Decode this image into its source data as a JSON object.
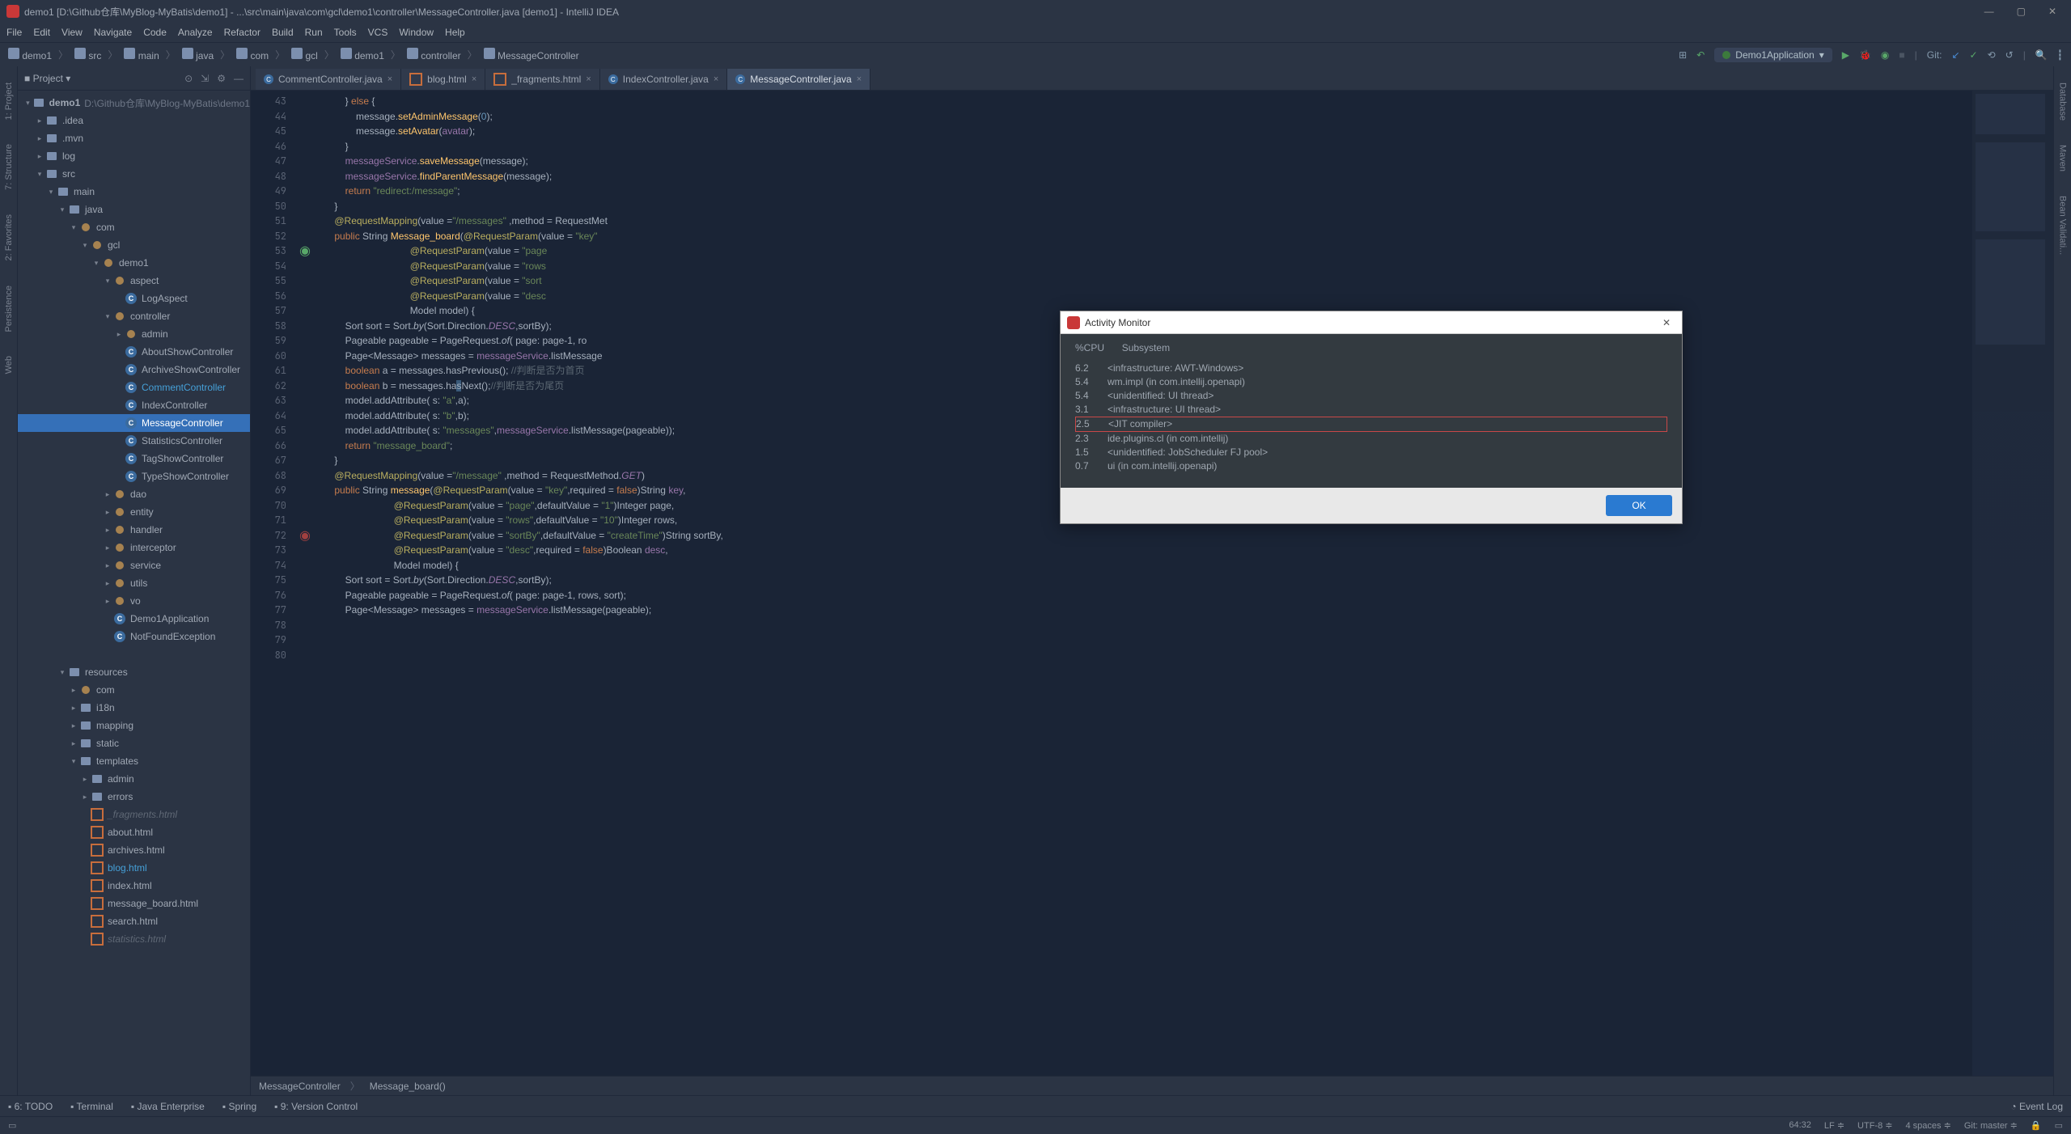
{
  "window": {
    "title": "demo1 [D:\\Github仓库\\MyBlog-MyBatis\\demo1] - ...\\src\\main\\java\\com\\gcl\\demo1\\controller\\MessageController.java [demo1] - IntelliJ IDEA"
  },
  "menu": [
    "File",
    "Edit",
    "View",
    "Navigate",
    "Code",
    "Analyze",
    "Refactor",
    "Build",
    "Run",
    "Tools",
    "VCS",
    "Window",
    "Help"
  ],
  "breadcrumb": [
    "demo1",
    "src",
    "main",
    "java",
    "com",
    "gcl",
    "demo1",
    "controller",
    "MessageController"
  ],
  "run_config": "Demo1Application",
  "git_label": "Git:",
  "sidebar": {
    "title": "Project",
    "root_label": "demo1",
    "root_hint": "D:\\Github仓库\\MyBlog-MyBatis\\demo1"
  },
  "tree": [
    {
      "d": 0,
      "a": "v",
      "ic": "folder",
      "t": "demo1",
      "hint": "D:\\Github仓库\\MyBlog-MyBatis\\demo1",
      "bold": true
    },
    {
      "d": 1,
      "a": ">",
      "ic": "folder",
      "t": ".idea"
    },
    {
      "d": 1,
      "a": ">",
      "ic": "folder",
      "t": ".mvn"
    },
    {
      "d": 1,
      "a": ">",
      "ic": "folder",
      "t": "log"
    },
    {
      "d": 1,
      "a": "v",
      "ic": "folder",
      "t": "src"
    },
    {
      "d": 2,
      "a": "v",
      "ic": "folder",
      "t": "main"
    },
    {
      "d": 3,
      "a": "v",
      "ic": "folder",
      "t": "java"
    },
    {
      "d": 4,
      "a": "v",
      "ic": "pkg",
      "t": "com"
    },
    {
      "d": 5,
      "a": "v",
      "ic": "pkg",
      "t": "gcl"
    },
    {
      "d": 6,
      "a": "v",
      "ic": "pkg",
      "t": "demo1"
    },
    {
      "d": 7,
      "a": "v",
      "ic": "pkg",
      "t": "aspect"
    },
    {
      "d": 8,
      "a": "",
      "ic": "cls",
      "t": "LogAspect"
    },
    {
      "d": 7,
      "a": "v",
      "ic": "pkg",
      "t": "controller"
    },
    {
      "d": 8,
      "a": ">",
      "ic": "pkg",
      "t": "admin"
    },
    {
      "d": 8,
      "a": "",
      "ic": "cls",
      "t": "AboutShowController"
    },
    {
      "d": 8,
      "a": "",
      "ic": "cls",
      "t": "ArchiveShowController"
    },
    {
      "d": 8,
      "a": "",
      "ic": "cls",
      "t": "CommentController",
      "clr": "#45a0d8"
    },
    {
      "d": 8,
      "a": "",
      "ic": "cls",
      "t": "IndexController"
    },
    {
      "d": 8,
      "a": "",
      "ic": "cls",
      "t": "MessageController",
      "sel": true
    },
    {
      "d": 8,
      "a": "",
      "ic": "cls",
      "t": "StatisticsController"
    },
    {
      "d": 8,
      "a": "",
      "ic": "cls",
      "t": "TagShowController"
    },
    {
      "d": 8,
      "a": "",
      "ic": "cls",
      "t": "TypeShowController"
    },
    {
      "d": 7,
      "a": ">",
      "ic": "pkg",
      "t": "dao"
    },
    {
      "d": 7,
      "a": ">",
      "ic": "pkg",
      "t": "entity"
    },
    {
      "d": 7,
      "a": ">",
      "ic": "pkg",
      "t": "handler"
    },
    {
      "d": 7,
      "a": ">",
      "ic": "pkg",
      "t": "interceptor"
    },
    {
      "d": 7,
      "a": ">",
      "ic": "pkg",
      "t": "service"
    },
    {
      "d": 7,
      "a": ">",
      "ic": "pkg",
      "t": "utils"
    },
    {
      "d": 7,
      "a": ">",
      "ic": "pkg",
      "t": "vo"
    },
    {
      "d": 7,
      "a": "",
      "ic": "cls",
      "t": "Demo1Application"
    },
    {
      "d": 7,
      "a": "",
      "ic": "cls",
      "t": "NotFoundException"
    },
    {
      "d": 0,
      "a": "",
      "ic": "",
      "t": ""
    },
    {
      "d": 3,
      "a": "v",
      "ic": "folder",
      "t": "resources"
    },
    {
      "d": 4,
      "a": ">",
      "ic": "pkg",
      "t": "com"
    },
    {
      "d": 4,
      "a": ">",
      "ic": "folder",
      "t": "i18n"
    },
    {
      "d": 4,
      "a": ">",
      "ic": "folder",
      "t": "mapping"
    },
    {
      "d": 4,
      "a": ">",
      "ic": "folder",
      "t": "static"
    },
    {
      "d": 4,
      "a": "v",
      "ic": "folder",
      "t": "templates"
    },
    {
      "d": 5,
      "a": ">",
      "ic": "folder",
      "t": "admin"
    },
    {
      "d": 5,
      "a": ">",
      "ic": "folder",
      "t": "errors"
    },
    {
      "d": 5,
      "a": "",
      "ic": "html",
      "t": "_fragments.html",
      "italic": true
    },
    {
      "d": 5,
      "a": "",
      "ic": "html",
      "t": "about.html"
    },
    {
      "d": 5,
      "a": "",
      "ic": "html",
      "t": "archives.html"
    },
    {
      "d": 5,
      "a": "",
      "ic": "html",
      "t": "blog.html",
      "clr": "#45a0d8"
    },
    {
      "d": 5,
      "a": "",
      "ic": "html",
      "t": "index.html"
    },
    {
      "d": 5,
      "a": "",
      "ic": "html",
      "t": "message_board.html"
    },
    {
      "d": 5,
      "a": "",
      "ic": "html",
      "t": "search.html"
    },
    {
      "d": 5,
      "a": "",
      "ic": "html",
      "t": "statistics.html",
      "italic": true
    }
  ],
  "tabs": [
    {
      "label": "CommentController.java",
      "ic": "c"
    },
    {
      "label": "blog.html",
      "ic": "h"
    },
    {
      "label": "_fragments.html",
      "ic": "h"
    },
    {
      "label": "IndexController.java",
      "ic": "c"
    },
    {
      "label": "MessageController.java",
      "ic": "c",
      "active": true
    }
  ],
  "line_start": 43,
  "editor_crumb": [
    "MessageController",
    "Message_board()"
  ],
  "bottom_tools": {
    "left": [
      "6: TODO",
      "Terminal",
      "Java Enterprise",
      "Spring",
      "9: Version Control"
    ],
    "right": "Event Log"
  },
  "status": {
    "pos": "64:32",
    "sep": "LF",
    "enc": "UTF-8",
    "indent": "4 spaces",
    "git": "Git: master"
  },
  "left_tools": [
    "1: Project",
    "7: Structure",
    "2: Favorites",
    "Persistence",
    "Web"
  ],
  "right_tools": [
    "Database",
    "Maven",
    "Bean Validati..."
  ],
  "dialog": {
    "title": "Activity Monitor",
    "col1": "%CPU",
    "col2": "Subsystem",
    "rows": [
      {
        "cpu": "6.2",
        "sub": "<infrastructure: AWT-Windows>"
      },
      {
        "cpu": "5.4",
        "sub": "wm.impl (in com.intellij.openapi)"
      },
      {
        "cpu": "5.4",
        "sub": "<unidentified: UI thread>"
      },
      {
        "cpu": "3.1",
        "sub": "<infrastructure: UI thread>"
      },
      {
        "cpu": "2.5",
        "sub": "<JIT compiler>",
        "sel": true
      },
      {
        "cpu": "2.3",
        "sub": "ide.plugins.cl (in com.intellij)"
      },
      {
        "cpu": "1.5",
        "sub": "<unidentified: JobScheduler FJ pool>"
      },
      {
        "cpu": "0.7",
        "sub": "ui (in com.intellij.openapi)"
      }
    ],
    "ok": "OK"
  }
}
